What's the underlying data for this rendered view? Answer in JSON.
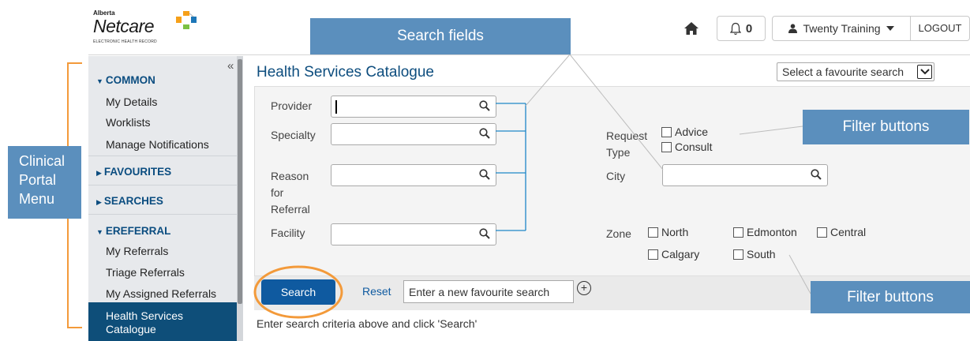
{
  "header": {
    "logo_small": "Alberta",
    "logo_big": "Netcare",
    "logo_tag": "ELECTRONIC HEALTH RECORD",
    "notification_count": "0",
    "user_name": "Twenty Training",
    "logout_label": "LOGOUT"
  },
  "sidebar": {
    "collapse_glyph": "«",
    "sections": {
      "common": "COMMON",
      "favourites": "FAVOURITES",
      "searches": "SEARCHES",
      "ereferral": "EREFERRAL"
    },
    "common_items": [
      "My Details",
      "Worklists",
      "Manage Notifications"
    ],
    "ereferral_items": [
      "My Referrals",
      "Triage Referrals",
      "My Assigned Referrals"
    ],
    "active_item": {
      "line1": "Health Services",
      "line2": "Catalogue"
    }
  },
  "main": {
    "title": "Health Services Catalogue",
    "favourite_select": "Select a favourite search",
    "fields": {
      "provider": "Provider",
      "specialty": "Specialty",
      "reason": {
        "line1": "Reason",
        "line2": "for",
        "line3": "Referral"
      },
      "facility": "Facility",
      "request_type": {
        "line1": "Request",
        "line2": "Type"
      },
      "city": "City",
      "zone": "Zone"
    },
    "request_types": [
      "Advice",
      "Consult"
    ],
    "zones": [
      "North",
      "Edmonton",
      "Central",
      "Calgary",
      "South"
    ],
    "search_label": "Search",
    "reset_label": "Reset",
    "new_favourite_placeholder": "Enter a new favourite search",
    "plus_glyph": "+",
    "hint": "Enter search criteria above and click 'Search'"
  },
  "annotations": {
    "search_fields": "Search fields",
    "filter_buttons_1": "Filter buttons",
    "filter_buttons_2": "Filter buttons",
    "menu": {
      "line1": "Clinical",
      "line2": "Portal",
      "line3": "Menu"
    }
  },
  "colors": {
    "callout": "#5b8fbd",
    "brand_blue": "#0d4d7e",
    "active_nav": "#0e4e79",
    "search_button": "#0f5aa0",
    "highlight_orange": "#f39a3a"
  },
  "icons": [
    "home-icon",
    "bell-icon",
    "user-icon",
    "caret-down-icon",
    "magnifier-icon",
    "plus-circle-icon",
    "collapse-icon"
  ]
}
